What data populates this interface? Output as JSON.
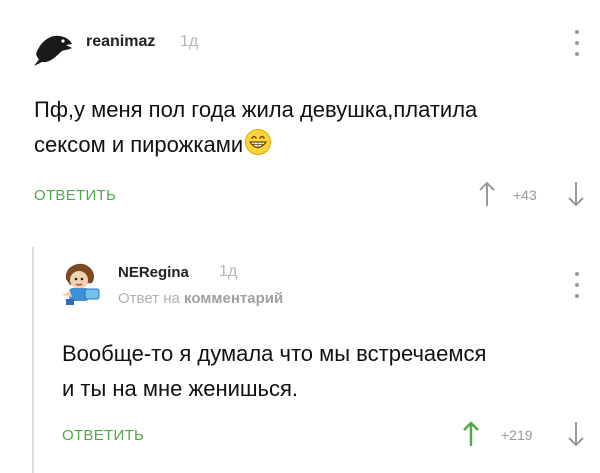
{
  "comments": [
    {
      "author": "reanimaz",
      "time": "1д",
      "text_line1": "Пф,у меня пол года жила девушка,платила",
      "text_line2": "сексом и пирожками",
      "reply_label": "ОТВЕТИТЬ",
      "score": "+43",
      "avatar": "crow-avatar",
      "emoji": "grinning-face-emoji"
    },
    {
      "author": "NERegina",
      "time": "1д",
      "reply_to_prefix": "Ответ на",
      "reply_to_link": "комментарий",
      "text_line1": "Вообще-то я думала что мы встречаемся",
      "text_line2": "и ты на мне женишься.",
      "reply_label": "ОТВЕТИТЬ",
      "score": "+219",
      "avatar": "cartoon-girl-avatar"
    }
  ],
  "colors": {
    "reply_green": "#4fa84c",
    "upvote_active": "#4fa84c",
    "muted_gray": "#9a9a9a",
    "thread_line": "#dcdcdc"
  },
  "icons": {
    "upvote": "arrow-up-icon",
    "downvote": "arrow-down-icon",
    "more": "kebab-menu-icon"
  }
}
